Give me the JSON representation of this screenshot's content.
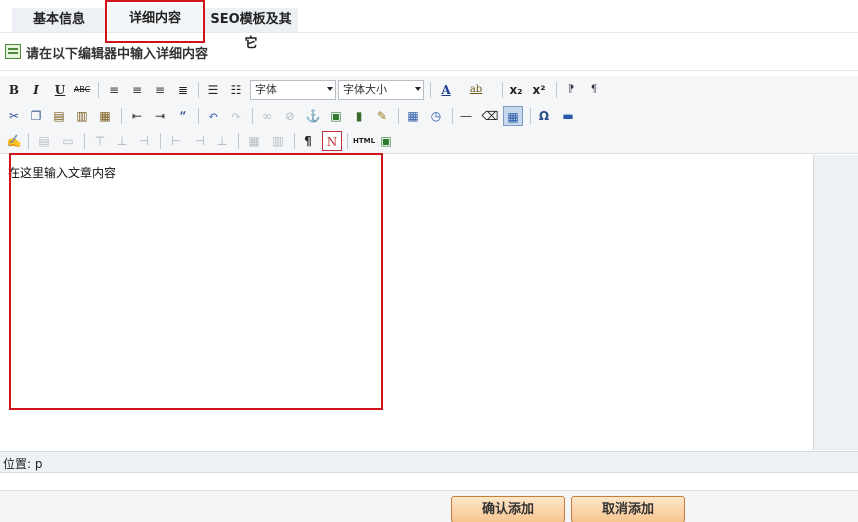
{
  "tabs": [
    {
      "label": "基本信息"
    },
    {
      "label": "详细内容"
    },
    {
      "label": "SEO模板及其它"
    }
  ],
  "section": {
    "title": "请在以下编辑器中输入详细内容"
  },
  "toolbar": {
    "font_select": "字体",
    "size_select": "字体大小",
    "strike_label": "ABC",
    "html_label": "HTML",
    "sub_label": "x₂",
    "sup_label": "x²",
    "omega_label": "Ω",
    "pilcrow_label": "¶"
  },
  "editor": {
    "content": "在这里输入文章内容"
  },
  "status": {
    "text": "位置: p"
  },
  "actions": {
    "confirm": "确认添加",
    "cancel": "取消添加"
  },
  "colors": {
    "highlight": "#d0141b",
    "button_fill": "#f7c690",
    "toolbar_bg": "#f4f6f8"
  }
}
